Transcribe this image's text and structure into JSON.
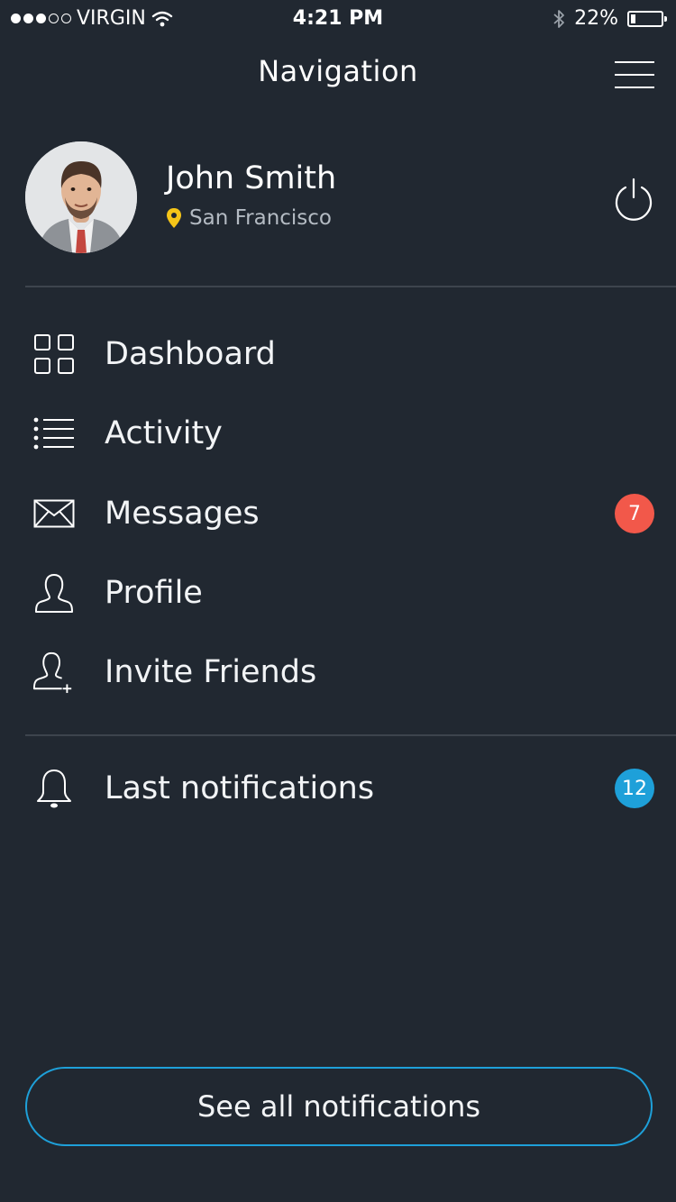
{
  "status_bar": {
    "carrier": "VIRGIN",
    "time": "4:21 PM",
    "battery_percent": "22%",
    "battery_level": 0.22,
    "signal_bars_filled": 3,
    "signal_bars_total": 5
  },
  "header": {
    "title": "Navigation"
  },
  "profile": {
    "name": "John Smith",
    "location": "San Francisco"
  },
  "menu": [
    {
      "label": "Dashboard",
      "icon": "grid-icon"
    },
    {
      "label": "Activity",
      "icon": "list-icon"
    },
    {
      "label": "Messages",
      "icon": "envelope-icon",
      "badge": "7"
    },
    {
      "label": "Profile",
      "icon": "user-icon"
    },
    {
      "label": "Invite Friends",
      "icon": "user-plus-icon"
    }
  ],
  "notifications": {
    "label": "Last notifications",
    "icon": "bell-icon",
    "badge": "12",
    "see_all_label": "See all notifications"
  },
  "colors": {
    "background": "#212831",
    "divider": "#3d444d",
    "message_badge": "#f2584a",
    "notification_badge": "#1ea0d9",
    "location_pin": "#f5c518",
    "button_border": "#1ea0d9"
  }
}
